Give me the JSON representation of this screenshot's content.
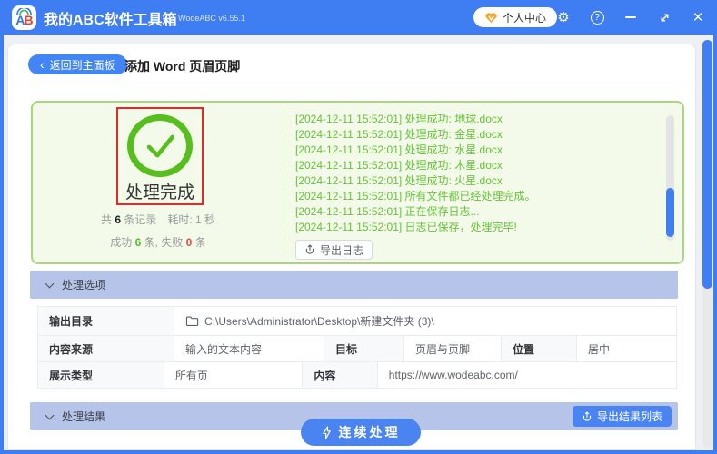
{
  "titlebar": {
    "logo_text_a": "A",
    "logo_text_b": "B",
    "app_title": "我的ABC软件工具箱",
    "version": "WodeABC v6.55.1",
    "user_center": "个人中心",
    "help_glyph": "?",
    "gear_glyph": "⚙",
    "close_glyph": "×"
  },
  "subheader": {
    "back_chevron": "‹",
    "back_label": "返回到主面板",
    "page_title": "添加 Word 页眉页脚"
  },
  "result": {
    "status": "处理完成",
    "total_prefix": "共 ",
    "total_count": "6",
    "total_suffix": " 条记录　耗时: 1 秒",
    "success_label": "成功 ",
    "success_count": "6",
    "success_mid": " 条, 失败 ",
    "fail_count": "0",
    "fail_suffix": " 条",
    "export_log": "导出日志",
    "logs": [
      "[2024-12-11 15:52:01] 处理成功: 地球.docx",
      "[2024-12-11 15:52:01] 处理成功: 金星.docx",
      "[2024-12-11 15:52:01] 处理成功: 水星.docx",
      "[2024-12-11 15:52:01] 处理成功: 木星.docx",
      "[2024-12-11 15:52:01] 处理成功: 火星.docx",
      "[2024-12-11 15:52:01] 所有文件都已经处理完成。",
      "[2024-12-11 15:52:01] 正在保存日志...",
      "[2024-12-11 15:52:01] 日志已保存，处理完毕!"
    ]
  },
  "options": {
    "title": "处理选项",
    "output_label": "输出目录",
    "output_value": "C:\\Users\\Administrator\\Desktop\\新建文件夹 (3)\\",
    "source_label": "内容来源",
    "source_value": "输入的文本内容",
    "target_label": "目标",
    "target_value": "页眉与页脚",
    "position_label": "位置",
    "position_value": "居中",
    "display_label": "展示类型",
    "display_value": "所有页",
    "content_label": "内容",
    "content_value": "https://www.wodeabc.com/"
  },
  "results_section": {
    "title": "处理结果",
    "export_list": "导出结果列表"
  },
  "actions": {
    "continue": "连续处理"
  },
  "colors": {
    "accent_blue": "#3e7ef2",
    "button_blue": "#4a84f0",
    "success_green": "#67c23a",
    "ring_green": "#57be1e",
    "panel_bg": "#f3fae9",
    "panel_border": "#a9d87c",
    "annotation_red": "#e02b2b",
    "fail_red": "#e84b3c",
    "section_bar": "#b6c4e9",
    "vip_orange": "#f5a623"
  }
}
